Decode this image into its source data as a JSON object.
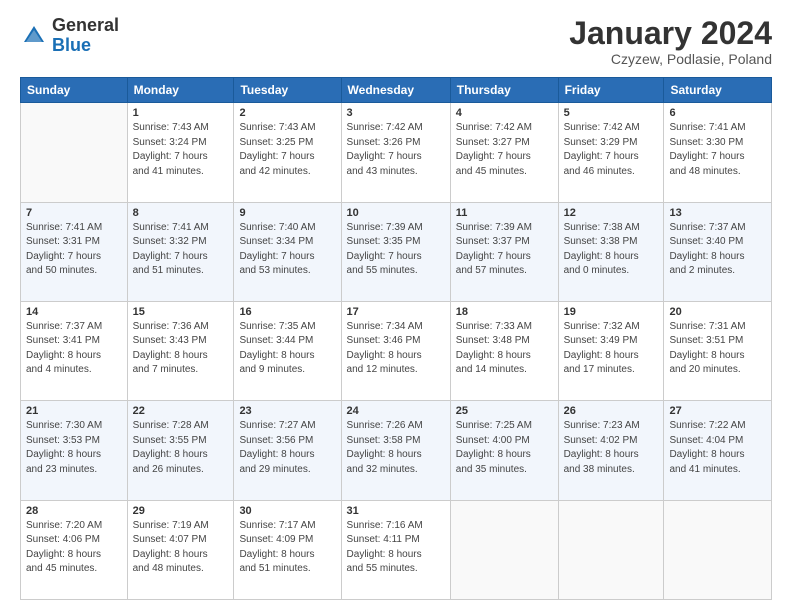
{
  "header": {
    "logo_general": "General",
    "logo_blue": "Blue",
    "month_title": "January 2024",
    "subtitle": "Czyzew, Podlasie, Poland"
  },
  "days_of_week": [
    "Sunday",
    "Monday",
    "Tuesday",
    "Wednesday",
    "Thursday",
    "Friday",
    "Saturday"
  ],
  "weeks": [
    [
      {
        "day": "",
        "info": ""
      },
      {
        "day": "1",
        "info": "Sunrise: 7:43 AM\nSunset: 3:24 PM\nDaylight: 7 hours\nand 41 minutes."
      },
      {
        "day": "2",
        "info": "Sunrise: 7:43 AM\nSunset: 3:25 PM\nDaylight: 7 hours\nand 42 minutes."
      },
      {
        "day": "3",
        "info": "Sunrise: 7:42 AM\nSunset: 3:26 PM\nDaylight: 7 hours\nand 43 minutes."
      },
      {
        "day": "4",
        "info": "Sunrise: 7:42 AM\nSunset: 3:27 PM\nDaylight: 7 hours\nand 45 minutes."
      },
      {
        "day": "5",
        "info": "Sunrise: 7:42 AM\nSunset: 3:29 PM\nDaylight: 7 hours\nand 46 minutes."
      },
      {
        "day": "6",
        "info": "Sunrise: 7:41 AM\nSunset: 3:30 PM\nDaylight: 7 hours\nand 48 minutes."
      }
    ],
    [
      {
        "day": "7",
        "info": "Sunrise: 7:41 AM\nSunset: 3:31 PM\nDaylight: 7 hours\nand 50 minutes."
      },
      {
        "day": "8",
        "info": "Sunrise: 7:41 AM\nSunset: 3:32 PM\nDaylight: 7 hours\nand 51 minutes."
      },
      {
        "day": "9",
        "info": "Sunrise: 7:40 AM\nSunset: 3:34 PM\nDaylight: 7 hours\nand 53 minutes."
      },
      {
        "day": "10",
        "info": "Sunrise: 7:39 AM\nSunset: 3:35 PM\nDaylight: 7 hours\nand 55 minutes."
      },
      {
        "day": "11",
        "info": "Sunrise: 7:39 AM\nSunset: 3:37 PM\nDaylight: 7 hours\nand 57 minutes."
      },
      {
        "day": "12",
        "info": "Sunrise: 7:38 AM\nSunset: 3:38 PM\nDaylight: 8 hours\nand 0 minutes."
      },
      {
        "day": "13",
        "info": "Sunrise: 7:37 AM\nSunset: 3:40 PM\nDaylight: 8 hours\nand 2 minutes."
      }
    ],
    [
      {
        "day": "14",
        "info": "Sunrise: 7:37 AM\nSunset: 3:41 PM\nDaylight: 8 hours\nand 4 minutes."
      },
      {
        "day": "15",
        "info": "Sunrise: 7:36 AM\nSunset: 3:43 PM\nDaylight: 8 hours\nand 7 minutes."
      },
      {
        "day": "16",
        "info": "Sunrise: 7:35 AM\nSunset: 3:44 PM\nDaylight: 8 hours\nand 9 minutes."
      },
      {
        "day": "17",
        "info": "Sunrise: 7:34 AM\nSunset: 3:46 PM\nDaylight: 8 hours\nand 12 minutes."
      },
      {
        "day": "18",
        "info": "Sunrise: 7:33 AM\nSunset: 3:48 PM\nDaylight: 8 hours\nand 14 minutes."
      },
      {
        "day": "19",
        "info": "Sunrise: 7:32 AM\nSunset: 3:49 PM\nDaylight: 8 hours\nand 17 minutes."
      },
      {
        "day": "20",
        "info": "Sunrise: 7:31 AM\nSunset: 3:51 PM\nDaylight: 8 hours\nand 20 minutes."
      }
    ],
    [
      {
        "day": "21",
        "info": "Sunrise: 7:30 AM\nSunset: 3:53 PM\nDaylight: 8 hours\nand 23 minutes."
      },
      {
        "day": "22",
        "info": "Sunrise: 7:28 AM\nSunset: 3:55 PM\nDaylight: 8 hours\nand 26 minutes."
      },
      {
        "day": "23",
        "info": "Sunrise: 7:27 AM\nSunset: 3:56 PM\nDaylight: 8 hours\nand 29 minutes."
      },
      {
        "day": "24",
        "info": "Sunrise: 7:26 AM\nSunset: 3:58 PM\nDaylight: 8 hours\nand 32 minutes."
      },
      {
        "day": "25",
        "info": "Sunrise: 7:25 AM\nSunset: 4:00 PM\nDaylight: 8 hours\nand 35 minutes."
      },
      {
        "day": "26",
        "info": "Sunrise: 7:23 AM\nSunset: 4:02 PM\nDaylight: 8 hours\nand 38 minutes."
      },
      {
        "day": "27",
        "info": "Sunrise: 7:22 AM\nSunset: 4:04 PM\nDaylight: 8 hours\nand 41 minutes."
      }
    ],
    [
      {
        "day": "28",
        "info": "Sunrise: 7:20 AM\nSunset: 4:06 PM\nDaylight: 8 hours\nand 45 minutes."
      },
      {
        "day": "29",
        "info": "Sunrise: 7:19 AM\nSunset: 4:07 PM\nDaylight: 8 hours\nand 48 minutes."
      },
      {
        "day": "30",
        "info": "Sunrise: 7:17 AM\nSunset: 4:09 PM\nDaylight: 8 hours\nand 51 minutes."
      },
      {
        "day": "31",
        "info": "Sunrise: 7:16 AM\nSunset: 4:11 PM\nDaylight: 8 hours\nand 55 minutes."
      },
      {
        "day": "",
        "info": ""
      },
      {
        "day": "",
        "info": ""
      },
      {
        "day": "",
        "info": ""
      }
    ]
  ]
}
